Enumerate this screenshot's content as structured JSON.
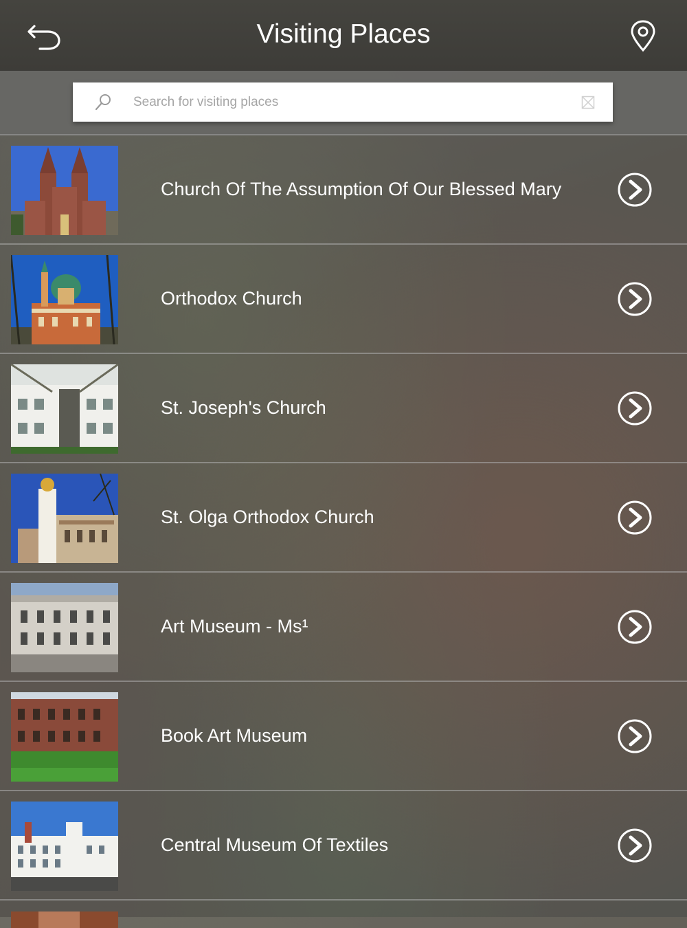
{
  "header": {
    "title": "Visiting Places",
    "back_icon": "back-arrow-icon",
    "map_icon": "map-pin-icon"
  },
  "search": {
    "placeholder": "Search for visiting places",
    "value": "",
    "search_icon": "magnifier-icon",
    "clear_icon": "clear-icon"
  },
  "places": [
    {
      "name": "Church Of The Assumption Of Our Blessed Mary",
      "thumb": "thumb-church-brick"
    },
    {
      "name": "Orthodox Church",
      "thumb": "thumb-orthodox-dome"
    },
    {
      "name": "St. Joseph's Church",
      "thumb": "thumb-white-building"
    },
    {
      "name": "St. Olga Orthodox Church",
      "thumb": "thumb-bell-tower"
    },
    {
      "name": "Art Museum - Ms¹",
      "thumb": "thumb-palace"
    },
    {
      "name": "Book Art Museum",
      "thumb": "thumb-brick-house"
    },
    {
      "name": "Central Museum Of Textiles",
      "thumb": "thumb-factory"
    }
  ],
  "colors": {
    "header_bg": "#3d3c38",
    "text": "#ffffff",
    "placeholder": "#a5a5a5"
  }
}
